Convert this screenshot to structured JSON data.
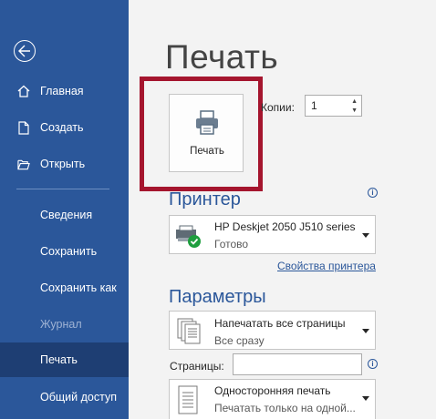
{
  "sidebar": {
    "items": [
      {
        "label": "Главная"
      },
      {
        "label": "Создать"
      },
      {
        "label": "Открыть"
      },
      {
        "label": "Сведения"
      },
      {
        "label": "Сохранить"
      },
      {
        "label": "Сохранить как"
      },
      {
        "label": "Журнал"
      },
      {
        "label": "Печать"
      },
      {
        "label": "Общий доступ"
      }
    ]
  },
  "main": {
    "title": "Печать",
    "print_button_label": "Печать",
    "copies_label": "Копии:",
    "copies_value": "1",
    "printer_section_title": "Принтер",
    "printer": {
      "name": "HP Deskjet 2050 J510 series",
      "status": "Готово"
    },
    "printer_properties_link": "Свойства принтера",
    "settings_section_title": "Параметры",
    "print_range": {
      "main": "Напечатать все страницы",
      "sub": "Все сразу"
    },
    "pages_label": "Страницы:",
    "pages_value": "",
    "sides": {
      "main": "Односторонняя печать",
      "sub": "Печатать только на одной..."
    }
  },
  "colors": {
    "accent": "#2b579a",
    "sidebar_active": "#1e3e73",
    "highlight": "#a5152e",
    "ready_badge": "#1e9e3e"
  },
  "icons": [
    "back-arrow-icon",
    "home-icon",
    "new-document-icon",
    "open-folder-icon",
    "printer-icon",
    "printer-status-icon",
    "ready-check-icon",
    "pages-icon",
    "one-sided-icon",
    "info-icon"
  ]
}
